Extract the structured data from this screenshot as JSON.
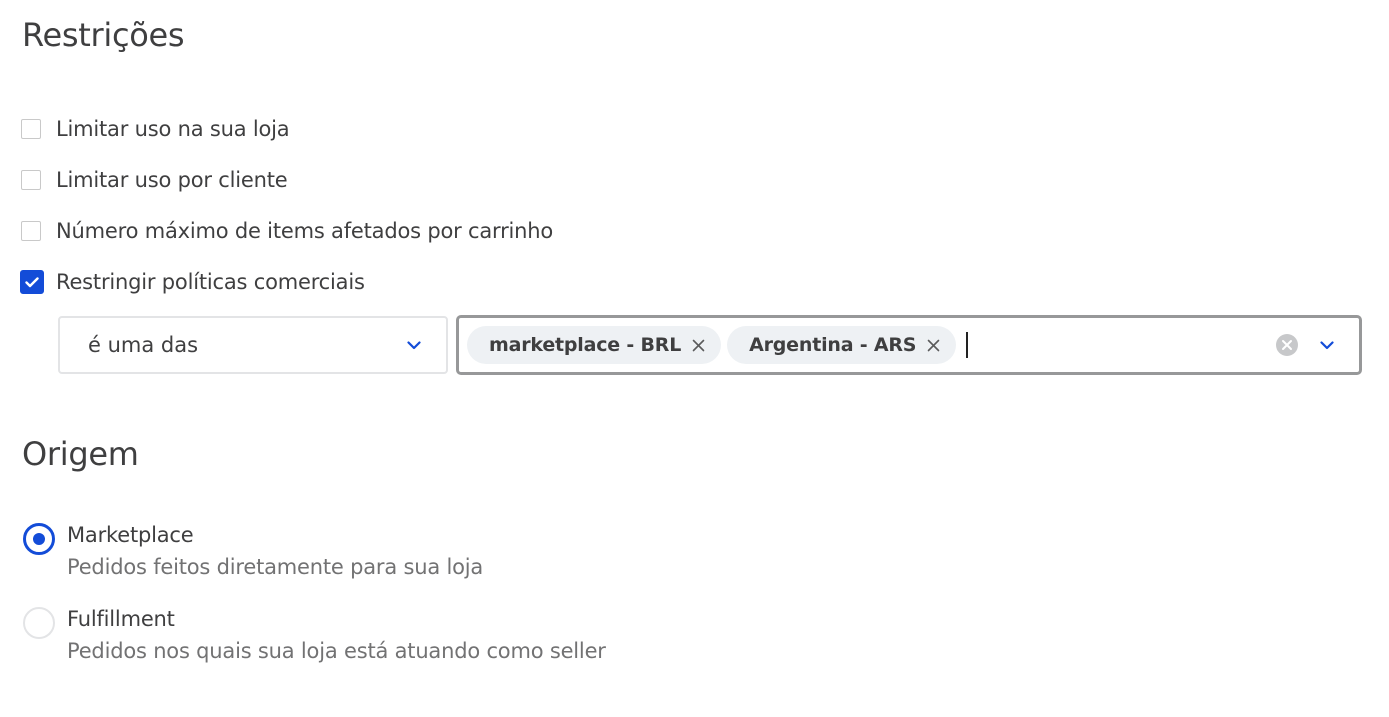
{
  "restricoes": {
    "title": "Restrições",
    "options": [
      {
        "label": "Limitar uso na sua loja",
        "checked": false
      },
      {
        "label": "Limitar uso por cliente",
        "checked": false
      },
      {
        "label": "Número máximo de items afetados por carrinho",
        "checked": false
      },
      {
        "label": "Restringir políticas comerciais",
        "checked": true
      }
    ],
    "operator_select": {
      "value": "é uma das",
      "icon": "chevron-down-icon"
    },
    "policies_multiselect": {
      "tags": [
        "marketplace - BRL",
        "Argentina - ARS"
      ],
      "value": "",
      "clear_icon": "clear-icon",
      "dropdown_icon": "chevron-down-icon"
    }
  },
  "origem": {
    "title": "Origem",
    "options": [
      {
        "label": "Marketplace",
        "description": "Pedidos feitos diretamente para sua loja",
        "selected": true
      },
      {
        "label": "Fulfillment",
        "description": "Pedidos nos quais sua loja está atuando como seller",
        "selected": false
      }
    ]
  },
  "colors": {
    "accent": "#134cd8",
    "text": "#3f3f40",
    "muted": "#727273",
    "border": "#e3e4e6",
    "tag_bg": "#eef1f4"
  }
}
